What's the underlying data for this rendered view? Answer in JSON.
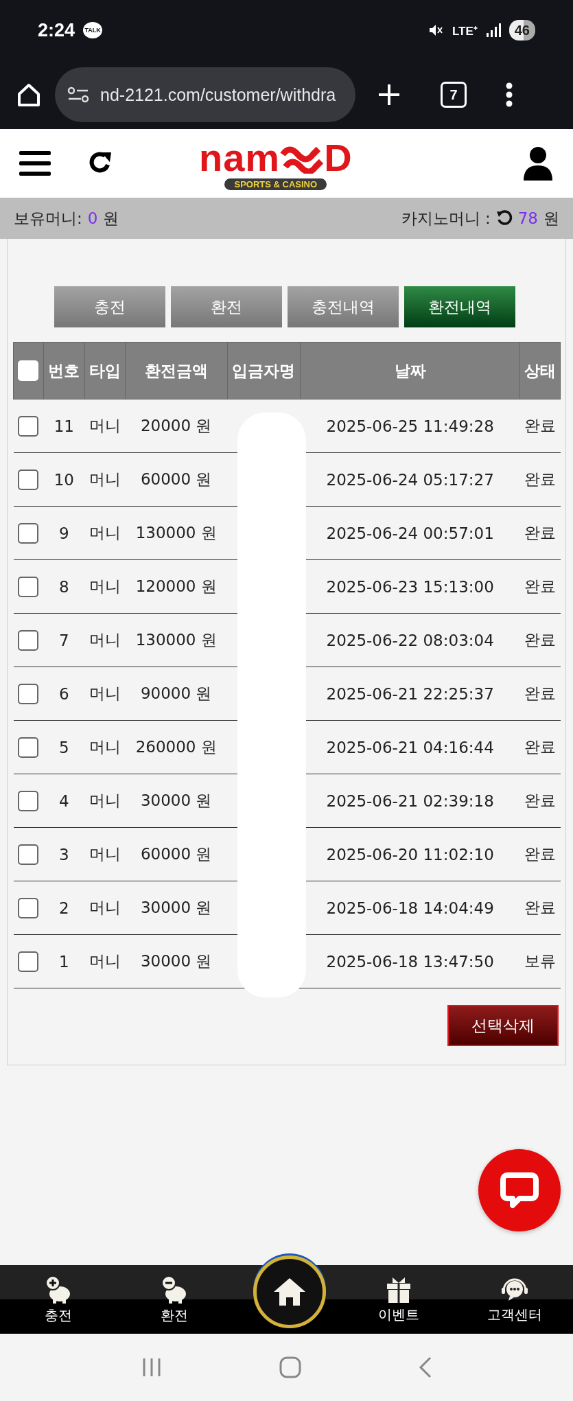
{
  "status_bar": {
    "time": "2:24",
    "notification": "TALK",
    "network": "LTE⁺",
    "battery": "46"
  },
  "browser": {
    "url": "nd-2121.com/customer/withdra",
    "tab_count": "7"
  },
  "header": {
    "logo_start": "nam",
    "logo_end": "D",
    "logo_tagline": "SPORTS & CASINO"
  },
  "balance": {
    "money_label": "보유머니:",
    "money_value": "0",
    "money_unit": "원",
    "casino_label": "카지노머니 :",
    "casino_value": "78",
    "casino_unit": "원"
  },
  "tabs": [
    {
      "label": "충전",
      "selected": false
    },
    {
      "label": "환전",
      "selected": false
    },
    {
      "label": "충전내역",
      "selected": false
    },
    {
      "label": "환전내역",
      "selected": true
    }
  ],
  "table": {
    "select_all_checked": false,
    "columns": [
      "번호",
      "타입",
      "환전금액",
      "입금자명",
      "날짜",
      "상태"
    ],
    "rows": [
      {
        "checked": false,
        "number": "11",
        "type": "머니",
        "amount": "20000 원",
        "date": "2025-06-25 11:49:28",
        "status": "완료"
      },
      {
        "checked": false,
        "number": "10",
        "type": "머니",
        "amount": "60000 원",
        "date": "2025-06-24 05:17:27",
        "status": "완료"
      },
      {
        "checked": false,
        "number": "9",
        "type": "머니",
        "amount": "130000 원",
        "date": "2025-06-24 00:57:01",
        "status": "완료"
      },
      {
        "checked": false,
        "number": "8",
        "type": "머니",
        "amount": "120000 원",
        "date": "2025-06-23 15:13:00",
        "status": "완료"
      },
      {
        "checked": false,
        "number": "7",
        "type": "머니",
        "amount": "130000 원",
        "date": "2025-06-22 08:03:04",
        "status": "완료"
      },
      {
        "checked": false,
        "number": "6",
        "type": "머니",
        "amount": "90000 원",
        "date": "2025-06-21 22:25:37",
        "status": "완료"
      },
      {
        "checked": false,
        "number": "5",
        "type": "머니",
        "amount": "260000 원",
        "date": "2025-06-21 04:16:44",
        "status": "완료"
      },
      {
        "checked": false,
        "number": "4",
        "type": "머니",
        "amount": "30000 원",
        "date": "2025-06-21 02:39:18",
        "status": "완료"
      },
      {
        "checked": false,
        "number": "3",
        "type": "머니",
        "amount": "60000 원",
        "date": "2025-06-20 11:02:10",
        "status": "완료"
      },
      {
        "checked": false,
        "number": "2",
        "type": "머니",
        "amount": "30000 원",
        "date": "2025-06-18 14:04:49",
        "status": "완료"
      },
      {
        "checked": false,
        "number": "1",
        "type": "머니",
        "amount": "30000 원",
        "date": "2025-06-18 13:47:50",
        "status": "보류"
      }
    ]
  },
  "delete_button": "선택삭제",
  "bottom_nav": [
    {
      "kind": "charge",
      "label": "충전"
    },
    {
      "kind": "exchange",
      "label": "환전"
    },
    {
      "kind": "home"
    },
    {
      "kind": "event",
      "label": "이벤트"
    },
    {
      "kind": "support",
      "label": "고객센터"
    }
  ]
}
